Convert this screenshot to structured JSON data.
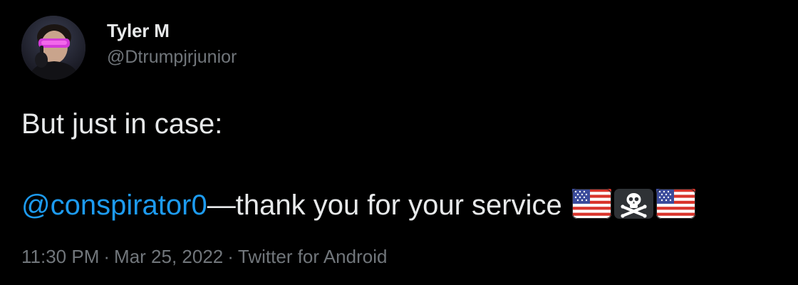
{
  "user": {
    "display_name": "Tyler M",
    "handle": "@Dtrumpjrjunior",
    "avatar_icon": "profile-avatar-image"
  },
  "tweet": {
    "line1": "But just in case:",
    "mention": "@conspirator0",
    "text_after_mention": "—thank you for your service",
    "emojis": [
      "us-flag-emoji",
      "skull-and-crossbones-emoji",
      "us-flag-emoji"
    ]
  },
  "meta": {
    "time": "11:30 PM",
    "separator": "·",
    "date": "Mar 25, 2022",
    "source": "Twitter for Android"
  },
  "colors": {
    "background": "#000000",
    "text": "#e7e9ea",
    "secondary": "#71767b",
    "link": "#1d9bf0"
  }
}
